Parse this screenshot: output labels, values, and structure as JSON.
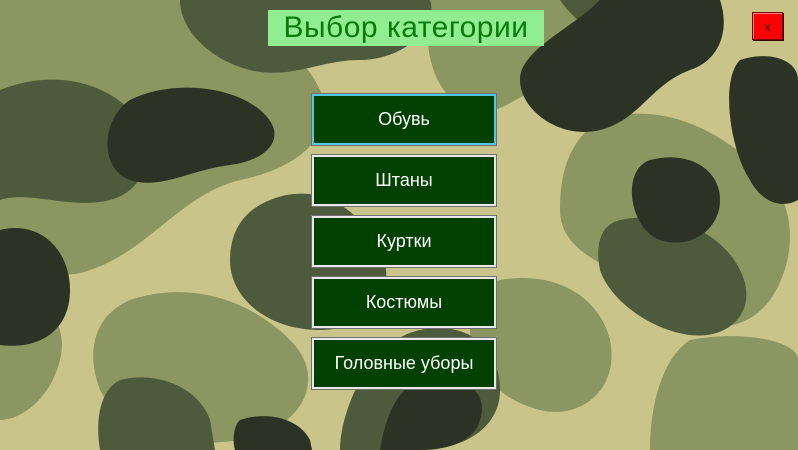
{
  "window": {
    "title": "Выбор категории",
    "close_label": "x"
  },
  "menu": {
    "items": [
      {
        "label": "Обувь"
      },
      {
        "label": "Штаны"
      },
      {
        "label": "Куртки"
      },
      {
        "label": "Костюмы"
      },
      {
        "label": "Головные уборы"
      }
    ]
  },
  "colors": {
    "button_bg": "#004000",
    "title_bg": "#90ee90",
    "title_text": "#0b7a0b",
    "close_bg": "#ff0000",
    "focus_border": "#53c7e6",
    "camo_light": "#c9c48a",
    "camo_olive": "#8b9660",
    "camo_dark_olive": "#4e5a3c",
    "camo_darkest": "#2c3324"
  }
}
